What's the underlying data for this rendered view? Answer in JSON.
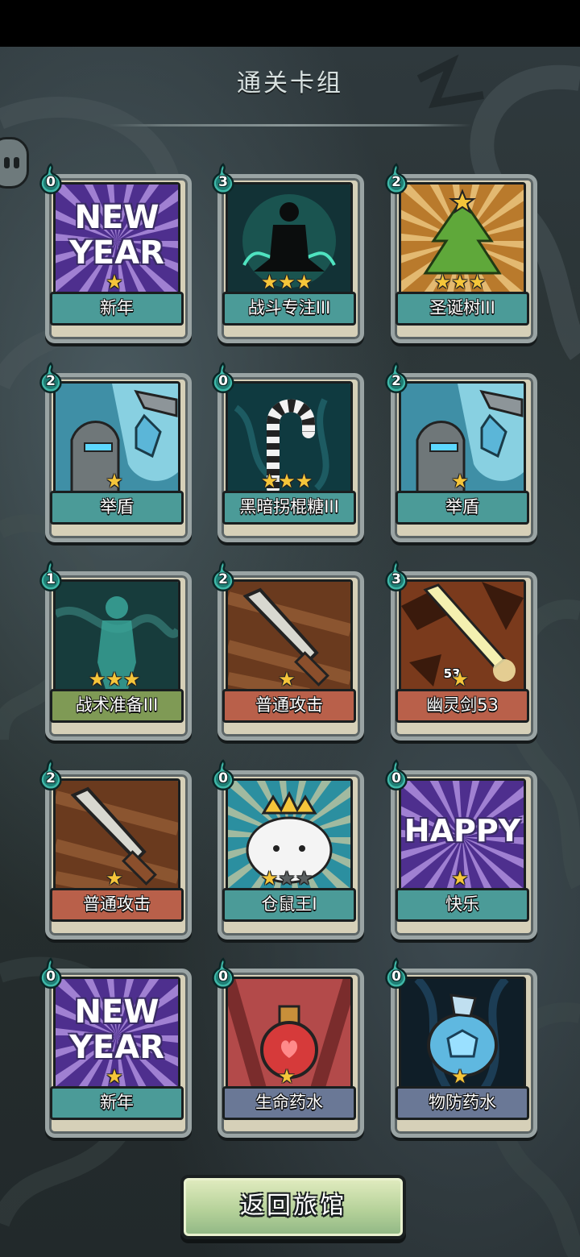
{
  "title": "通关卡组",
  "return_button": "返回旅馆",
  "cards": [
    {
      "name": "新年",
      "cost": "0",
      "stars": 1,
      "label_color": "teal",
      "art": "new-year",
      "art_text": [
        "NEW",
        "YEAR"
      ]
    },
    {
      "name": "战斗专注III",
      "cost": "3",
      "stars": 3,
      "label_color": "teal",
      "art": "focus"
    },
    {
      "name": "圣诞树III",
      "cost": "2",
      "stars": 3,
      "label_color": "teal",
      "art": "tree"
    },
    {
      "name": "举盾",
      "cost": "2",
      "stars": 1,
      "label_color": "teal",
      "art": "shield"
    },
    {
      "name": "黑暗拐棍糖III",
      "cost": "0",
      "stars": 3,
      "label_color": "teal",
      "art": "candy"
    },
    {
      "name": "举盾",
      "cost": "2",
      "stars": 1,
      "label_color": "teal",
      "art": "shield"
    },
    {
      "name": "战术准备III",
      "cost": "1",
      "stars": 3,
      "label_color": "green",
      "art": "prep"
    },
    {
      "name": "普通攻击",
      "cost": "2",
      "stars": 1,
      "label_color": "red",
      "art": "sword"
    },
    {
      "name": "幽灵剑53",
      "cost": "3",
      "stars": 1,
      "label_color": "red",
      "art": "ghost-sword",
      "level": "53"
    },
    {
      "name": "普通攻击",
      "cost": "2",
      "stars": 1,
      "label_color": "red",
      "art": "sword"
    },
    {
      "name": "仓鼠王I",
      "cost": "0",
      "stars": 1,
      "stars_total": 3,
      "label_color": "teal",
      "art": "hamster"
    },
    {
      "name": "快乐",
      "cost": "0",
      "stars": 1,
      "label_color": "teal",
      "art": "happy",
      "art_text": [
        "HAPPY"
      ]
    },
    {
      "name": "新年",
      "cost": "0",
      "stars": 1,
      "label_color": "teal",
      "art": "new-year",
      "art_text": [
        "NEW",
        "YEAR"
      ]
    },
    {
      "name": "生命药水",
      "cost": "0",
      "stars": 1,
      "label_color": "blue",
      "art": "potion"
    },
    {
      "name": "物防药水",
      "cost": "0",
      "stars": 1,
      "label_color": "blue",
      "art": "armor-potion"
    }
  ]
}
